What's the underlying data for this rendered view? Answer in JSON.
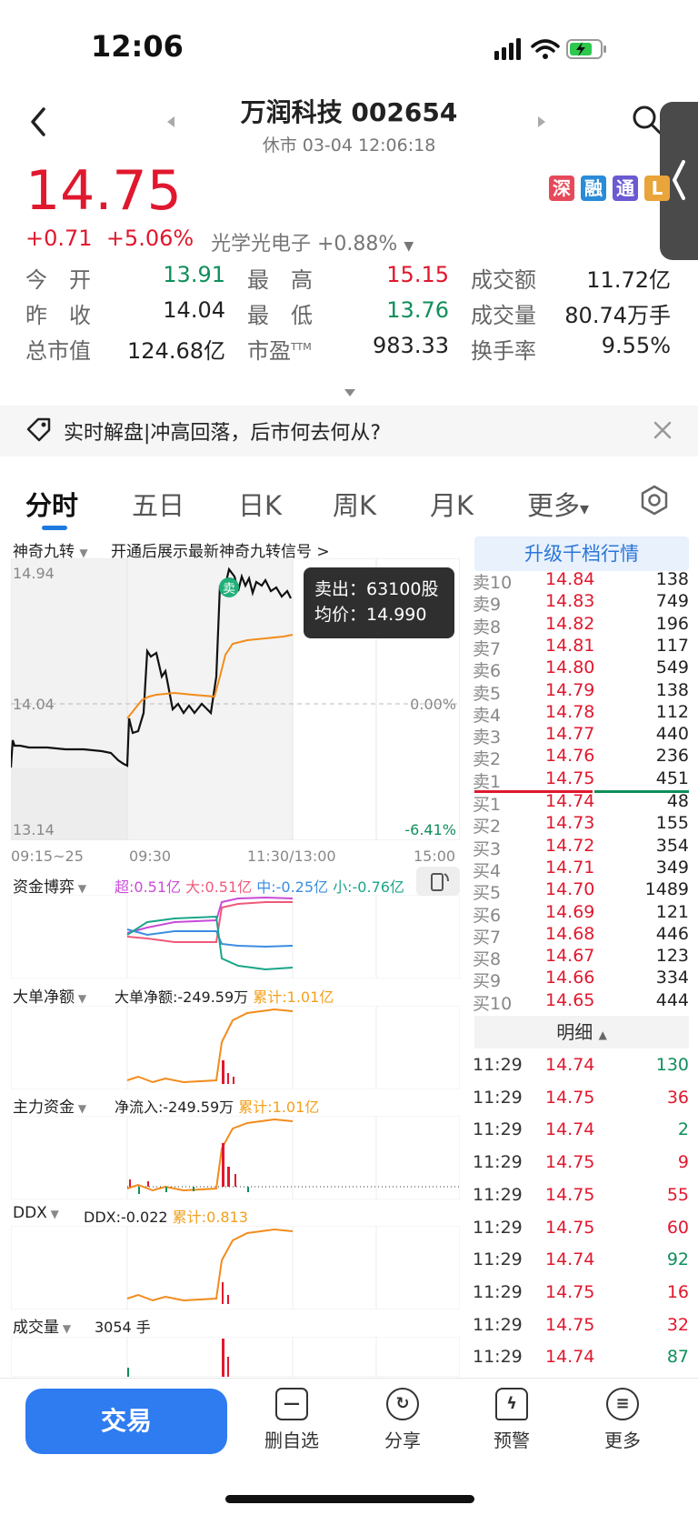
{
  "status": {
    "time": "12:06"
  },
  "header": {
    "title": "万润科技 002654",
    "subtitle": "休市 03-04 12:06:18"
  },
  "quote": {
    "price": "14.75",
    "change": "+0.71",
    "pct": "+5.06%",
    "sector": "光学光电子 +0.88%",
    "badges": [
      {
        "text": "深",
        "color": "#e64a5a"
      },
      {
        "text": "融",
        "color": "#2a8bd8"
      },
      {
        "text": "通",
        "color": "#6a5ad1"
      },
      {
        "text": "L",
        "color": "#e9a43a"
      }
    ],
    "stats": [
      {
        "label": "今　开",
        "value": "13.91",
        "color": "green"
      },
      {
        "label": "最　高",
        "value": "15.15",
        "color": "red"
      },
      {
        "label": "成交额",
        "value": "11.72亿",
        "color": "dark"
      },
      {
        "label": "昨　收",
        "value": "14.04",
        "color": "dark"
      },
      {
        "label": "最　低",
        "value": "13.76",
        "color": "green"
      },
      {
        "label": "成交量",
        "value": "80.74万手",
        "color": "dark"
      },
      {
        "label": "总市值",
        "value": "124.68亿",
        "color": "dark"
      },
      {
        "label": "市盈",
        "value": "983.33",
        "color": "dark",
        "sup": "TTM"
      },
      {
        "label": "换手率",
        "value": "9.55%",
        "color": "dark"
      }
    ]
  },
  "news": {
    "text": "实时解盘|冲高回落，后市何去何从?"
  },
  "tabs": [
    "分时",
    "五日",
    "日K",
    "周K",
    "月K",
    "更多"
  ],
  "intraday": {
    "signal_label": "神奇九转",
    "signal_hint": "开通后展示最新神奇九转信号 >",
    "y_high": "14.94",
    "y_mid": "14.04",
    "y_low": "13.14",
    "pct_mid": "0.00%",
    "pct_low": "-6.41%",
    "x_labels": [
      "09:15~25",
      "09:30",
      "11:30/13:00",
      "15:00"
    ],
    "sell_marker": "卖",
    "tooltip_sell": "卖出：63100股",
    "tooltip_avg": "均价：14.990"
  },
  "panels": {
    "capital": {
      "label": "资金博弈",
      "super": "超:0.51亿",
      "big": "大:0.51亿",
      "mid": "中:-0.25亿",
      "small": "小:-0.76亿"
    },
    "bignet": {
      "label": "大单净额",
      "value": "大单净额:-249.59万",
      "cum": "累计:1.01亿"
    },
    "main": {
      "label": "主力资金",
      "value": "净流入:-249.59万",
      "cum": "累计:1.01亿"
    },
    "ddx": {
      "label": "DDX",
      "value": "DDX:-0.022",
      "cum": "累计:0.813"
    },
    "volume": {
      "label": "成交量",
      "value": "3054 手"
    }
  },
  "orderbook": {
    "upgrade": "升级千档行情",
    "asks": [
      {
        "l": "卖10",
        "p": "14.84",
        "v": "138"
      },
      {
        "l": "卖9",
        "p": "14.83",
        "v": "749"
      },
      {
        "l": "卖8",
        "p": "14.82",
        "v": "196"
      },
      {
        "l": "卖7",
        "p": "14.81",
        "v": "117"
      },
      {
        "l": "卖6",
        "p": "14.80",
        "v": "549"
      },
      {
        "l": "卖5",
        "p": "14.79",
        "v": "138"
      },
      {
        "l": "卖4",
        "p": "14.78",
        "v": "112"
      },
      {
        "l": "卖3",
        "p": "14.77",
        "v": "440"
      },
      {
        "l": "卖2",
        "p": "14.76",
        "v": "236"
      },
      {
        "l": "卖1",
        "p": "14.75",
        "v": "451"
      }
    ],
    "bids": [
      {
        "l": "买1",
        "p": "14.74",
        "v": "48"
      },
      {
        "l": "买2",
        "p": "14.73",
        "v": "155"
      },
      {
        "l": "买3",
        "p": "14.72",
        "v": "354"
      },
      {
        "l": "买4",
        "p": "14.71",
        "v": "349"
      },
      {
        "l": "买5",
        "p": "14.70",
        "v": "1489"
      },
      {
        "l": "买6",
        "p": "14.69",
        "v": "121"
      },
      {
        "l": "买7",
        "p": "14.68",
        "v": "446"
      },
      {
        "l": "买8",
        "p": "14.67",
        "v": "123"
      },
      {
        "l": "买9",
        "p": "14.66",
        "v": "334"
      },
      {
        "l": "买10",
        "p": "14.65",
        "v": "444"
      }
    ],
    "detail_label": "明细",
    "details": [
      {
        "t": "11:29",
        "p": "14.74",
        "v": "130",
        "c": "green"
      },
      {
        "t": "11:29",
        "p": "14.75",
        "v": "36",
        "c": "red"
      },
      {
        "t": "11:29",
        "p": "14.74",
        "v": "2",
        "c": "green"
      },
      {
        "t": "11:29",
        "p": "14.75",
        "v": "9",
        "c": "red"
      },
      {
        "t": "11:29",
        "p": "14.75",
        "v": "55",
        "c": "red"
      },
      {
        "t": "11:29",
        "p": "14.75",
        "v": "60",
        "c": "red"
      },
      {
        "t": "11:29",
        "p": "14.74",
        "v": "92",
        "c": "green"
      },
      {
        "t": "11:29",
        "p": "14.75",
        "v": "16",
        "c": "red"
      },
      {
        "t": "11:29",
        "p": "14.75",
        "v": "32",
        "c": "red"
      },
      {
        "t": "11:29",
        "p": "14.74",
        "v": "87",
        "c": "green"
      }
    ]
  },
  "bottom": {
    "trade": "交易",
    "nav": [
      {
        "label": "删自选",
        "icon": "minus-icon"
      },
      {
        "label": "分享",
        "icon": "share-icon"
      },
      {
        "label": "预警",
        "icon": "alert-icon"
      },
      {
        "label": "更多",
        "icon": "menu-icon"
      }
    ]
  }
}
